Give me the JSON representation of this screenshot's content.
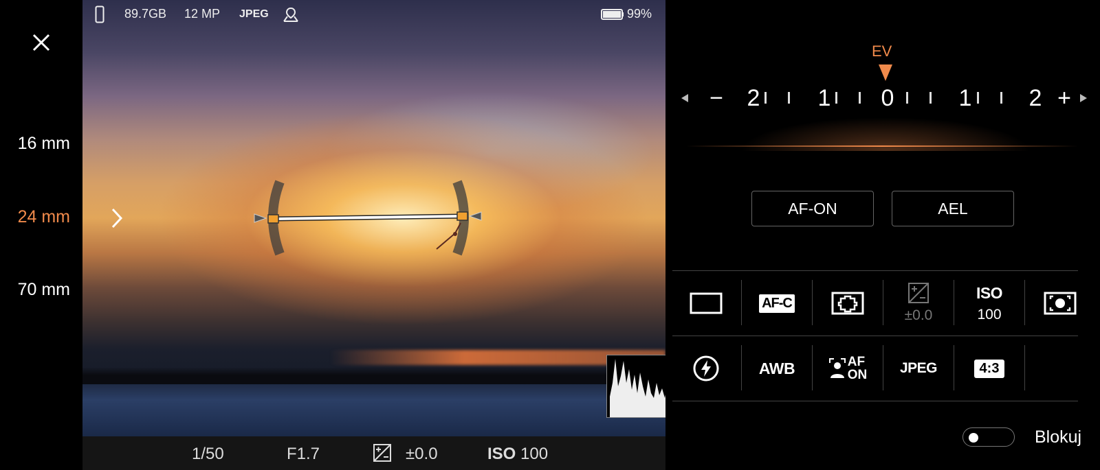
{
  "status": {
    "storage": "89.7GB",
    "megapixels": "12 MP",
    "format": "JPEG",
    "battery": "99%"
  },
  "lens": {
    "options": [
      "16 mm",
      "24 mm",
      "70 mm"
    ],
    "selected": "24 mm"
  },
  "exposure": {
    "shutter": "1/50",
    "aperture": "F1.7",
    "ev_value": "±0.0",
    "iso_label": "ISO",
    "iso_value": "100"
  },
  "ev_dial": {
    "label": "EV",
    "scale": [
      "−",
      "2",
      "1",
      "0",
      "1",
      "2",
      "+"
    ]
  },
  "buttons": {
    "af_on": "AF-ON",
    "ael": "AEL"
  },
  "settings_row1": {
    "focus_mode": "AF-C",
    "ev_value": "±0.0",
    "iso_label": "ISO",
    "iso_value": "100"
  },
  "settings_row2": {
    "white_balance": "AWB",
    "face_af_line1": "AF",
    "face_af_line2": "ON",
    "file_format": "JPEG",
    "aspect_ratio": "4:3"
  },
  "lock": {
    "label": "Blokuj",
    "on": false
  },
  "colors": {
    "accent": "#f08a4b",
    "background": "#000000"
  },
  "icons": [
    "close-icon",
    "chevron-right-icon",
    "phone-storage-icon",
    "location-icon",
    "battery-icon",
    "ev-compensation-icon",
    "drive-mode-icon",
    "focus-area-icon",
    "metering-icon",
    "flash-icon",
    "face-detection-icon"
  ]
}
